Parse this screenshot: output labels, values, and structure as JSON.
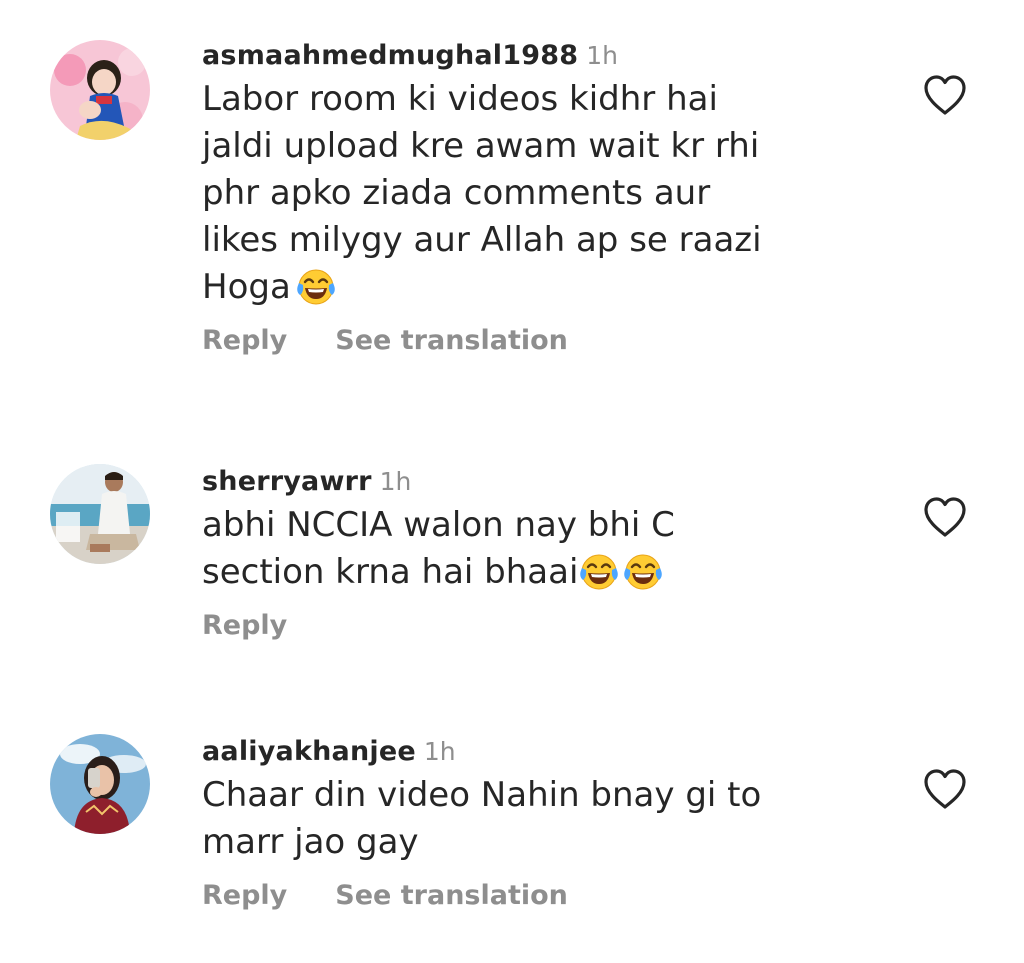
{
  "colors": {
    "text": "#262626",
    "muted": "#8e8e8e",
    "background": "#ffffff"
  },
  "comments": [
    {
      "username": "asmaahmedmughal1988",
      "time": "1h",
      "text": "Labor room ki videos kidhr hai\njaldi upload kre awam wait kr rhi\nphr apko ziada comments aur\nlikes milygy aur Allah ap se raazi\nHoga",
      "emoji": "face-with-tears-of-joy",
      "reply_label": "Reply",
      "translate_label": "See translation",
      "avatar": "snow-white-avatar",
      "like_icon": "heart-outline-icon"
    },
    {
      "username": "sherryawrr",
      "time": "1h",
      "text": "abhi NCCIA walon nay bhi C\nsection krna hai bhaai",
      "emoji": "face-with-tears-of-joy x2",
      "reply_label": "Reply",
      "avatar": "man-sea-avatar",
      "like_icon": "heart-outline-icon"
    },
    {
      "username": "aaliyakhanjee",
      "time": "1h",
      "text": "Chaar din video Nahin bnay gi to\nmarr jao gay",
      "reply_label": "Reply",
      "translate_label": "See translation",
      "avatar": "girl-selfie-avatar",
      "like_icon": "heart-outline-icon"
    }
  ]
}
